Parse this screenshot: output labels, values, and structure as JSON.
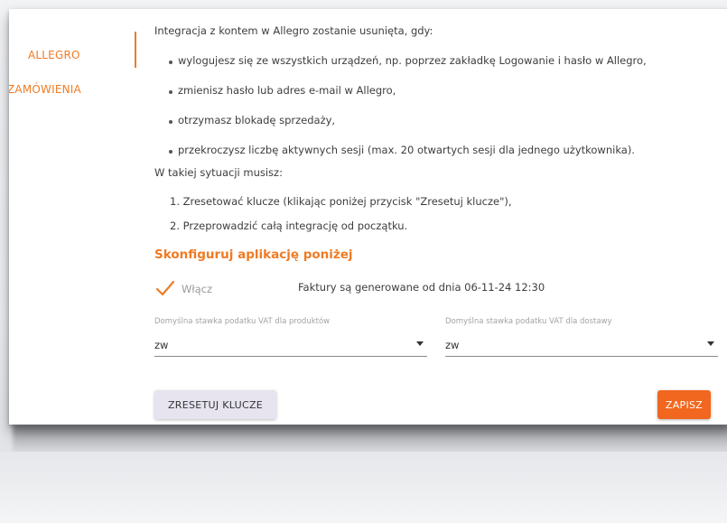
{
  "sidebar": {
    "items": [
      {
        "label": "ALLEGRO"
      },
      {
        "label": "ZAMÓWIENIA"
      }
    ]
  },
  "intro": "Integracja z kontem w Allegro zostanie usunięta, gdy:",
  "conditions": [
    "wylogujesz się ze wszystkich urządzeń, np. poprzez zakładkę Logowanie i hasło w Allegro,",
    "zmienisz hasło lub adres e-mail w Allegro,",
    "otrzymasz blokadę sprzedaży,",
    "przekroczysz liczbę aktywnych sesji (max. 20 otwartych sesji dla jednego użytkownika)."
  ],
  "action_intro": "W takiej sytuacji musisz:",
  "steps": [
    "1. Zresetować klucze (klikając poniżej przycisk \"Zresetuj klucze\"),",
    "2. Przeprowadzić całą integrację od początku."
  ],
  "config": {
    "title": "Skonfiguruj aplikację poniżej",
    "enable_label": "Włącz",
    "enabled": true,
    "info": "Faktury są generowane od dnia 06-11-24 12:30"
  },
  "vat_products": {
    "label": "Domyślna stawka podatku VAT dla produktów",
    "value": "zw"
  },
  "vat_delivery": {
    "label": "Domyślna stawka podatku VAT dla dostawy",
    "value": "zw"
  },
  "buttons": {
    "reset": "ZRESETUJ KLUCZE",
    "save": "ZAPISZ"
  },
  "colors": {
    "accent": "#ef7b24",
    "save_button": "#f2671f",
    "reset_button": "#e7e4f0"
  }
}
